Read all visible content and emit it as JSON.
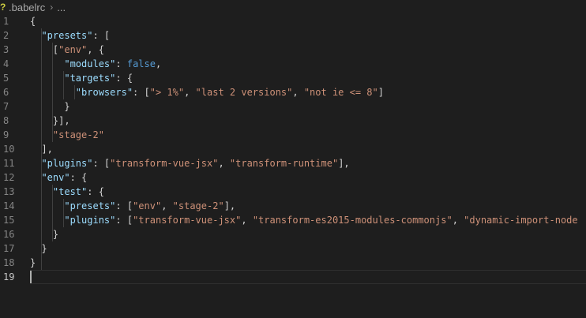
{
  "breadcrumb": {
    "file_icon": "babel-file-icon",
    "file_icon_glyph": "?",
    "filename": ".babelrc",
    "separator": "›",
    "more": "..."
  },
  "editor": {
    "active_line": 19,
    "line_numbers": [
      "1",
      "2",
      "3",
      "4",
      "5",
      "6",
      "7",
      "8",
      "9",
      "10",
      "11",
      "12",
      "13",
      "14",
      "15",
      "16",
      "17",
      "18",
      "19"
    ],
    "lines": [
      [
        {
          "t": "p",
          "v": "{"
        }
      ],
      [
        {
          "t": "p",
          "v": "  "
        },
        {
          "t": "k",
          "v": "\"presets\""
        },
        {
          "t": "p",
          "v": ": ["
        }
      ],
      [
        {
          "t": "p",
          "v": "    ["
        },
        {
          "t": "s",
          "v": "\"env\""
        },
        {
          "t": "p",
          "v": ", {"
        }
      ],
      [
        {
          "t": "p",
          "v": "      "
        },
        {
          "t": "k",
          "v": "\"modules\""
        },
        {
          "t": "p",
          "v": ": "
        },
        {
          "t": "b",
          "v": "false"
        },
        {
          "t": "p",
          "v": ","
        }
      ],
      [
        {
          "t": "p",
          "v": "      "
        },
        {
          "t": "k",
          "v": "\"targets\""
        },
        {
          "t": "p",
          "v": ": {"
        }
      ],
      [
        {
          "t": "p",
          "v": "        "
        },
        {
          "t": "k",
          "v": "\"browsers\""
        },
        {
          "t": "p",
          "v": ": ["
        },
        {
          "t": "s",
          "v": "\"> 1%\""
        },
        {
          "t": "p",
          "v": ", "
        },
        {
          "t": "s",
          "v": "\"last 2 versions\""
        },
        {
          "t": "p",
          "v": ", "
        },
        {
          "t": "s",
          "v": "\"not ie <= 8\""
        },
        {
          "t": "p",
          "v": "]"
        }
      ],
      [
        {
          "t": "p",
          "v": "      }"
        }
      ],
      [
        {
          "t": "p",
          "v": "    }],"
        }
      ],
      [
        {
          "t": "p",
          "v": "    "
        },
        {
          "t": "s",
          "v": "\"stage-2\""
        }
      ],
      [
        {
          "t": "p",
          "v": "  ],"
        }
      ],
      [
        {
          "t": "p",
          "v": "  "
        },
        {
          "t": "k",
          "v": "\"plugins\""
        },
        {
          "t": "p",
          "v": ": ["
        },
        {
          "t": "s",
          "v": "\"transform-vue-jsx\""
        },
        {
          "t": "p",
          "v": ", "
        },
        {
          "t": "s",
          "v": "\"transform-runtime\""
        },
        {
          "t": "p",
          "v": "],"
        }
      ],
      [
        {
          "t": "p",
          "v": "  "
        },
        {
          "t": "k",
          "v": "\"env\""
        },
        {
          "t": "p",
          "v": ": {"
        }
      ],
      [
        {
          "t": "p",
          "v": "    "
        },
        {
          "t": "k",
          "v": "\"test\""
        },
        {
          "t": "p",
          "v": ": {"
        }
      ],
      [
        {
          "t": "p",
          "v": "      "
        },
        {
          "t": "k",
          "v": "\"presets\""
        },
        {
          "t": "p",
          "v": ": ["
        },
        {
          "t": "s",
          "v": "\"env\""
        },
        {
          "t": "p",
          "v": ", "
        },
        {
          "t": "s",
          "v": "\"stage-2\""
        },
        {
          "t": "p",
          "v": "],"
        }
      ],
      [
        {
          "t": "p",
          "v": "      "
        },
        {
          "t": "k",
          "v": "\"plugins\""
        },
        {
          "t": "p",
          "v": ": ["
        },
        {
          "t": "s",
          "v": "\"transform-vue-jsx\""
        },
        {
          "t": "p",
          "v": ", "
        },
        {
          "t": "s",
          "v": "\"transform-es2015-modules-commonjs\""
        },
        {
          "t": "p",
          "v": ", "
        },
        {
          "t": "s",
          "v": "\"dynamic-import-node"
        }
      ],
      [
        {
          "t": "p",
          "v": "    }"
        }
      ],
      [
        {
          "t": "p",
          "v": "  }"
        }
      ],
      [
        {
          "t": "p",
          "v": "}"
        }
      ],
      []
    ]
  },
  "colors": {
    "background": "#1e1e1e",
    "key": "#9cdcfe",
    "string": "#ce9178",
    "boolean": "#569cd6",
    "punctuation": "#d4d4d4",
    "line_number": "#858585"
  }
}
